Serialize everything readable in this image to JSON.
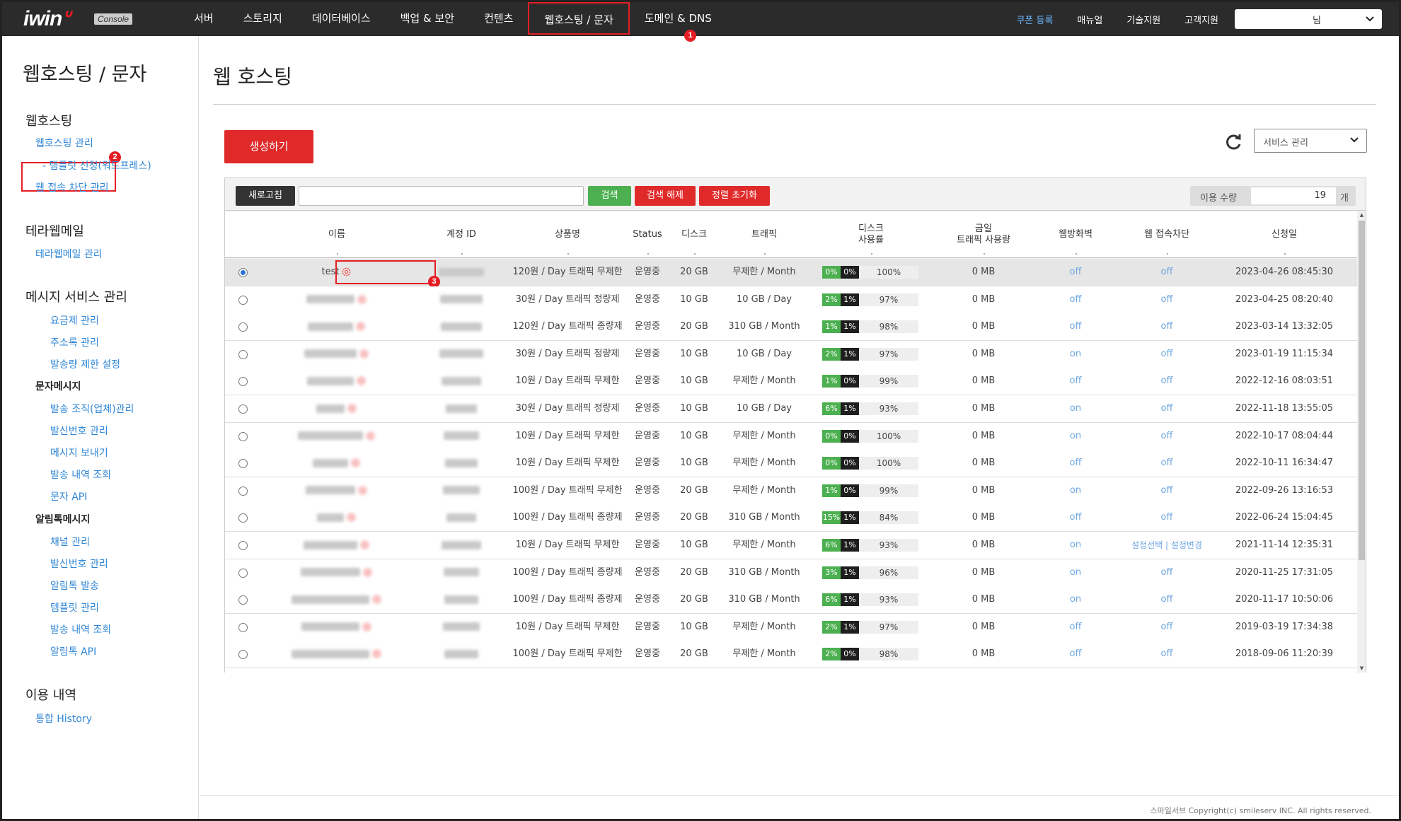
{
  "header": {
    "logo": "iwin",
    "console_label": "Console",
    "nav": [
      "서버",
      "스토리지",
      "데이터베이스",
      "백업 & 보안",
      "컨텐츠",
      "웹호스팅 / 문자",
      "도메인 & DNS"
    ],
    "active_nav_index": 5,
    "util": {
      "coupon": "쿠폰 등록",
      "manual": "매뉴얼",
      "tech": "기술지원",
      "support": "고객지원"
    },
    "user_suffix": "님"
  },
  "badges": {
    "b1": "1",
    "b2": "2",
    "b3": "3"
  },
  "sidebar": {
    "title": "웹호스팅 / 문자",
    "g1": "웹호스팅",
    "l_hosting_manage": "웹호스팅 관리",
    "l_template": "- 템플릿 신청(워드프레스)",
    "l_block": "웹 접속 차단 관리",
    "g2": "테라웹메일",
    "l_terra": "테라웹메일 관리",
    "g3": "메시지 서비스 관리",
    "l_rate": "요금제 관리",
    "l_addr": "주소록 관리",
    "l_limit": "발송량 제한 설정",
    "sub_sms": "문자메시지",
    "l_org": "발송 조직(업체)관리",
    "l_caller": "발신번호 관리",
    "l_send": "메시지 보내기",
    "l_history": "발송 내역 조회",
    "l_api": "문자 API",
    "sub_alim": "알림톡메시지",
    "l_channel": "채널 관리",
    "l_caller2": "발신번호 관리",
    "l_alim_send": "알림톡 발송",
    "l_tpl": "템플릿 관리",
    "l_history2": "발송 내역 조회",
    "l_alim_api": "알림톡 API",
    "g4": "이용 내역",
    "l_all_history": "통합 History"
  },
  "main": {
    "title": "웹 호스팅",
    "create_btn": "생성하기",
    "service_select": "서비스 관리",
    "toolbar": {
      "refresh": "새로고침",
      "search": "검색",
      "clear": "검색 해제",
      "reset_sort": "정렬 초기화",
      "usage_label": "이용 수량",
      "usage_value": "19",
      "usage_unit": "개"
    },
    "columns": {
      "name": "이름",
      "account": "계정 ID",
      "product": "상품명",
      "status": "Status",
      "disk": "디스크",
      "traffic": "트래픽",
      "disk_usage_1": "디스크",
      "disk_usage_2": "사용률",
      "today_traffic_1": "금일",
      "today_traffic_2": "트래픽 사용량",
      "firewall": "웹방화벽",
      "block": "웹 접속차단",
      "date": "신청일"
    },
    "rows": [
      {
        "name": "test",
        "product": "120원 / Day 트래픽 무제한",
        "status": "운영중",
        "disk": "20 GB",
        "traffic": "무제한 / Month",
        "g": "0%",
        "b": "0%",
        "p": "100%",
        "today": "0 MB",
        "fw": "off",
        "blk": "off",
        "date": "2023-04-26 08:45:30"
      },
      {
        "name": "",
        "product": "30원 / Day 트래픽 정량제",
        "status": "운영중",
        "disk": "10 GB",
        "traffic": "10 GB / Day",
        "g": "2%",
        "b": "1%",
        "p": "97%",
        "today": "0 MB",
        "fw": "off",
        "blk": "off",
        "date": "2023-04-25 08:20:40"
      },
      {
        "name": "",
        "product": "120원 / Day 트래픽 종량제",
        "status": "운영중",
        "disk": "20 GB",
        "traffic": "310 GB / Month",
        "g": "1%",
        "b": "1%",
        "p": "98%",
        "today": "0 MB",
        "fw": "off",
        "blk": "off",
        "date": "2023-03-14 13:32:05"
      },
      {
        "name": "",
        "product": "30원 / Day 트래픽 정량제",
        "status": "운영중",
        "disk": "10 GB",
        "traffic": "10 GB / Day",
        "g": "2%",
        "b": "1%",
        "p": "97%",
        "today": "0 MB",
        "fw": "on",
        "blk": "off",
        "date": "2023-01-19 11:15:34"
      },
      {
        "name": "",
        "product": "10원 / Day 트래픽 무제한",
        "status": "운영중",
        "disk": "10 GB",
        "traffic": "무제한 / Month",
        "g": "1%",
        "b": "0%",
        "p": "99%",
        "today": "0 MB",
        "fw": "off",
        "blk": "off",
        "date": "2022-12-16 08:03:51"
      },
      {
        "name": "",
        "product": "30원 / Day 트래픽 정량제",
        "status": "운영중",
        "disk": "10 GB",
        "traffic": "10 GB / Day",
        "g": "6%",
        "b": "1%",
        "p": "93%",
        "today": "0 MB",
        "fw": "on",
        "blk": "off",
        "date": "2022-11-18 13:55:05"
      },
      {
        "name": "",
        "product": "10원 / Day 트래픽 무제한",
        "status": "운영중",
        "disk": "10 GB",
        "traffic": "무제한 / Month",
        "g": "0%",
        "b": "0%",
        "p": "100%",
        "today": "0 MB",
        "fw": "on",
        "blk": "off",
        "date": "2022-10-17 08:04:44"
      },
      {
        "name": "",
        "product": "10원 / Day 트래픽 무제한",
        "status": "운영중",
        "disk": "10 GB",
        "traffic": "무제한 / Month",
        "g": "0%",
        "b": "0%",
        "p": "100%",
        "today": "0 MB",
        "fw": "off",
        "blk": "off",
        "date": "2022-10-11 16:34:47"
      },
      {
        "name": "",
        "product": "100원 / Day 트래픽 무제한",
        "status": "운영중",
        "disk": "20 GB",
        "traffic": "무제한 / Month",
        "g": "1%",
        "b": "0%",
        "p": "99%",
        "today": "0 MB",
        "fw": "on",
        "blk": "off",
        "date": "2022-09-26 13:16:53"
      },
      {
        "name": "",
        "product": "100원 / Day 트래픽 종량제",
        "status": "운영중",
        "disk": "20 GB",
        "traffic": "310 GB / Month",
        "g": "15%",
        "b": "1%",
        "p": "84%",
        "today": "0 MB",
        "fw": "off",
        "blk": "off",
        "date": "2022-06-24 15:04:45"
      },
      {
        "name": "",
        "product": "10원 / Day 트래픽 무제한",
        "status": "운영중",
        "disk": "10 GB",
        "traffic": "무제한 / Month",
        "g": "6%",
        "b": "1%",
        "p": "93%",
        "today": "0 MB",
        "fw": "on",
        "blk": "설정선택 | 설정변경",
        "date": "2021-11-14 12:35:31"
      },
      {
        "name": "",
        "product": "100원 / Day 트래픽 종량제",
        "status": "운영중",
        "disk": "20 GB",
        "traffic": "310 GB / Month",
        "g": "3%",
        "b": "1%",
        "p": "96%",
        "today": "0 MB",
        "fw": "on",
        "blk": "off",
        "date": "2020-11-25 17:31:05"
      },
      {
        "name": "",
        "product": "100원 / Day 트래픽 종량제",
        "status": "운영중",
        "disk": "20 GB",
        "traffic": "310 GB / Month",
        "g": "6%",
        "b": "1%",
        "p": "93%",
        "today": "0 MB",
        "fw": "on",
        "blk": "off",
        "date": "2020-11-17 10:50:06"
      },
      {
        "name": "",
        "product": "10원 / Day 트래픽 무제한",
        "status": "운영중",
        "disk": "10 GB",
        "traffic": "무제한 / Month",
        "g": "2%",
        "b": "1%",
        "p": "97%",
        "today": "0 MB",
        "fw": "off",
        "blk": "off",
        "date": "2019-03-19 17:34:38"
      },
      {
        "name": "",
        "product": "100원 / Day 트래픽 무제한",
        "status": "운영중",
        "disk": "20 GB",
        "traffic": "무제한 / Month",
        "g": "2%",
        "b": "0%",
        "p": "98%",
        "today": "0 MB",
        "fw": "off",
        "blk": "off",
        "date": "2018-09-06 11:20:39"
      }
    ]
  },
  "footer": "스마일서브 Copyright(c) smileserv INC. All rights reserved.",
  "colors": {
    "accent_red": "#e02a2a",
    "green": "#4cb050",
    "link_blue": "#2f86d6",
    "topbar": "#2b2b2b"
  }
}
